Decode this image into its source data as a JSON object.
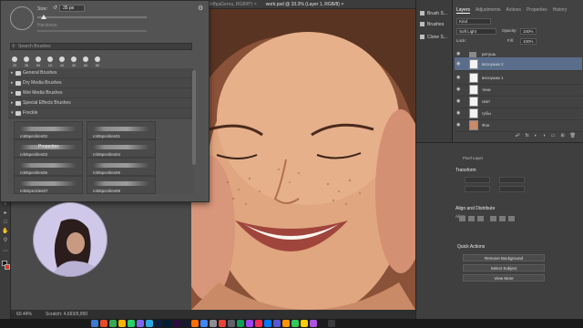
{
  "doc_tabs": [
    "loffpaGerna, RGB/8*) ×",
    "work.psd @ 33.3% (Layer 1, RGB/8) ×"
  ],
  "brush_panel": {
    "size_label": "Size:",
    "size_value": "35 px",
    "hardness_label": "Hardness:",
    "search_placeholder": "Search Brushes",
    "recent_sizes": [
      "25",
      "35",
      "50",
      "10",
      "40",
      "30",
      "60",
      "80"
    ],
    "folders": [
      "General Brushes",
      "Dry Media Brushes",
      "Wet Media Brushes",
      "Special Effects Brushes",
      "Freckle"
    ],
    "brushes": [
      "rckt5peckles02",
      "rckt5peckles01",
      "rckt5peckles03",
      "rckt5peckles04",
      "rckt5peckles06",
      "rckt5peckles05",
      "rcktSpeckles07",
      "rckt5peckles08"
    ]
  },
  "side_panel": {
    "items": [
      "Brush S...",
      "Brushes",
      "Clone S..."
    ]
  },
  "layers_panel": {
    "tabs": [
      "Layers",
      "Adjustments",
      "Actions",
      "Properties",
      "History"
    ],
    "kind_label": "Kind",
    "blend_mode": "Soft Light",
    "opacity_label": "Opacity:",
    "opacity_value": "100%",
    "lock_label": "Lock:",
    "fill_label": "Fill:",
    "fill_value": "100%",
    "layers": [
      {
        "name": "ретушь",
        "selected": false
      },
      {
        "name": "веснушки 2",
        "selected": true
      },
      {
        "name": "веснушки 1",
        "selected": false
      },
      {
        "name": "тени",
        "selected": false
      },
      {
        "name": "свет",
        "selected": false
      },
      {
        "name": "губы",
        "selected": false
      },
      {
        "name": "Фон",
        "selected": false
      }
    ]
  },
  "properties_panel": {
    "title": "Properties",
    "pixel_layer": "Pixel Layer",
    "transform": "Transform",
    "align_distribute": "Align and Distribute",
    "align_label": "Align:",
    "quick_actions": "Quick Actions",
    "remove_background": "Remove Background",
    "select_subject": "Select Subject",
    "view_more": "View More"
  },
  "status_bar": {
    "zoom": "60.44%",
    "info": "Scratch: 4,693/9,950"
  }
}
